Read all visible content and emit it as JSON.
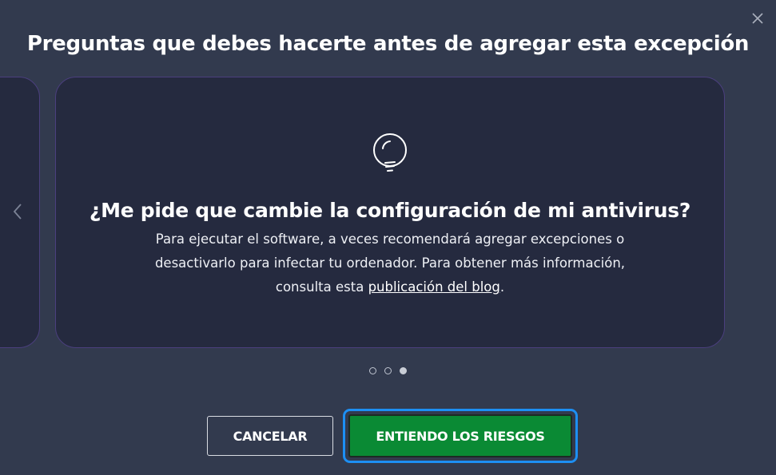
{
  "dialog": {
    "title": "Preguntas que debes hacerte antes de agregar esta excepción",
    "close_icon": "close-icon"
  },
  "carousel": {
    "prev_icon": "chevron-left-icon",
    "card": {
      "icon": "lightbulb-icon",
      "heading": "¿Me pide que cambie la configuración de mi antivirus?",
      "body_line1": "Para ejecutar el software, a veces recomendará agregar excepciones o",
      "body_line2": "desactivarlo para infectar tu ordenador. Para obtener más información,",
      "body_line3_prefix": "consulta esta ",
      "link_text": "publicación del blog",
      "body_line3_suffix": "."
    },
    "dots": {
      "count": 3,
      "active_index": 2
    }
  },
  "buttons": {
    "cancel_label": "CANCELAR",
    "accept_label": "ENTIENDO LOS RIESGOS"
  },
  "colors": {
    "background": "#323a4e",
    "card": "#252a3f",
    "card_border": "#4b3f7e",
    "accept": "#0a8a34",
    "focus_ring": "#1d8ff3"
  }
}
